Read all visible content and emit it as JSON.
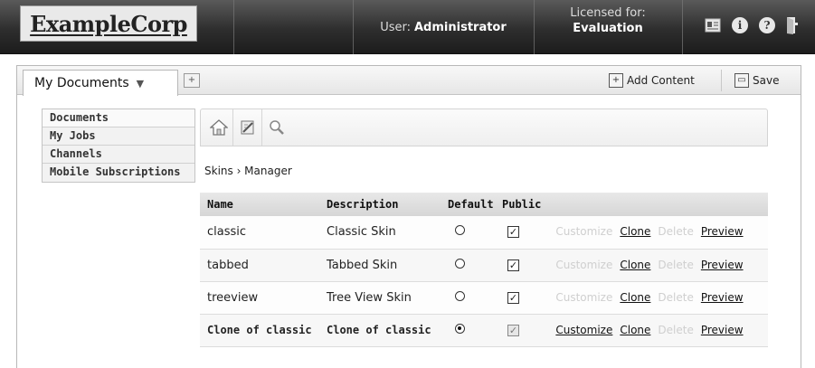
{
  "header": {
    "logo": "ExampleCorp",
    "user_label": "User:",
    "user_name": "Administrator",
    "license_label": "Licensed for:",
    "license_value": "Evaluation",
    "icons": [
      "id-card-icon",
      "info-icon",
      "help-icon",
      "logout-icon"
    ]
  },
  "tabs": {
    "active_label": "My Documents",
    "add_content": "Add Content",
    "save": "Save"
  },
  "sidebar": {
    "items": [
      {
        "label": "Documents"
      },
      {
        "label": "My Jobs"
      },
      {
        "label": "Channels"
      },
      {
        "label": "Mobile Subscriptions"
      }
    ]
  },
  "main": {
    "toolbar_icons": [
      "home-icon",
      "edit-icon",
      "search-icon"
    ],
    "breadcrumb": "Skins › Manager",
    "columns": [
      "Name",
      "Description",
      "Default",
      "Public"
    ],
    "actions": {
      "customize": "Customize",
      "clone": "Clone",
      "delete": "Delete",
      "preview": "Preview"
    },
    "rows": [
      {
        "name": "classic",
        "description": "Classic Skin",
        "default": false,
        "public": true,
        "customize_enabled": false
      },
      {
        "name": "tabbed",
        "description": "Tabbed Skin",
        "default": false,
        "public": true,
        "customize_enabled": false
      },
      {
        "name": "treeview",
        "description": "Tree View Skin",
        "default": false,
        "public": true,
        "customize_enabled": false
      },
      {
        "name": "Clone of classic",
        "description": "Clone of classic",
        "default": true,
        "public": true,
        "customize_enabled": true
      }
    ]
  }
}
